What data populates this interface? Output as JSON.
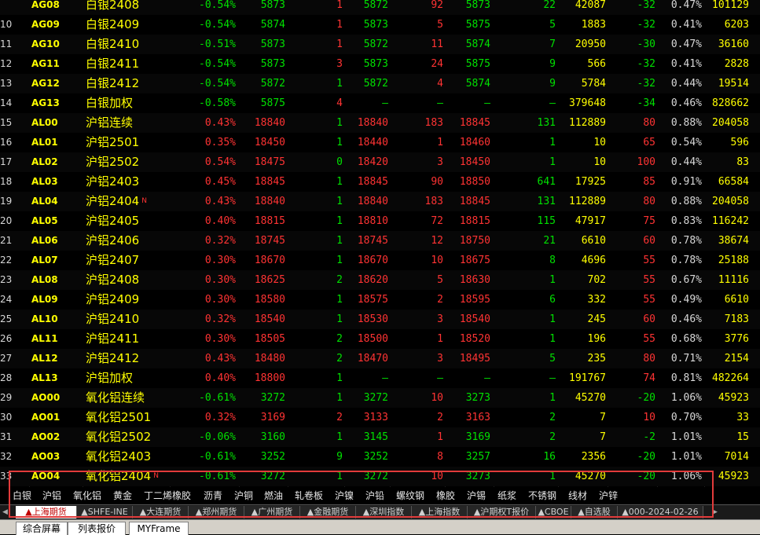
{
  "rows": [
    {
      "idx": "",
      "code": "AG08",
      "name": "白银2408",
      "flag": "",
      "pct": "-0.54%",
      "dir": "dn",
      "last": "5873",
      "vol": "1",
      "vcol": "up",
      "bid": "5872",
      "bidv": "92",
      "ask": "5873",
      "askv": "22",
      "tot": "42087",
      "chg": "-32",
      "chgdir": "dn",
      "opt": "0.47%",
      "oi": "101129"
    },
    {
      "idx": "10",
      "code": "AG09",
      "name": "白银2409",
      "flag": "",
      "pct": "-0.54%",
      "dir": "dn",
      "last": "5874",
      "vol": "1",
      "vcol": "up",
      "bid": "5873",
      "bidv": "5",
      "ask": "5875",
      "askv": "5",
      "tot": "1883",
      "chg": "-32",
      "chgdir": "dn",
      "opt": "0.41%",
      "oi": "6203"
    },
    {
      "idx": "11",
      "code": "AG10",
      "name": "白银2410",
      "flag": "",
      "pct": "-0.51%",
      "dir": "dn",
      "last": "5873",
      "vol": "1",
      "vcol": "up",
      "bid": "5872",
      "bidv": "11",
      "ask": "5874",
      "askv": "7",
      "tot": "20950",
      "chg": "-30",
      "chgdir": "dn",
      "opt": "0.47%",
      "oi": "36160"
    },
    {
      "idx": "12",
      "code": "AG11",
      "name": "白银2411",
      "flag": "",
      "pct": "-0.54%",
      "dir": "dn",
      "last": "5873",
      "vol": "3",
      "vcol": "up",
      "bid": "5873",
      "bidv": "24",
      "ask": "5875",
      "askv": "9",
      "tot": "566",
      "chg": "-32",
      "chgdir": "dn",
      "opt": "0.41%",
      "oi": "2828"
    },
    {
      "idx": "13",
      "code": "AG12",
      "name": "白银2412",
      "flag": "",
      "pct": "-0.54%",
      "dir": "dn",
      "last": "5872",
      "vol": "1",
      "vcol": "dn",
      "bid": "5872",
      "bidv": "4",
      "ask": "5874",
      "askv": "9",
      "tot": "5784",
      "chg": "-32",
      "chgdir": "dn",
      "opt": "0.44%",
      "oi": "19514"
    },
    {
      "idx": "14",
      "code": "AG13",
      "name": "白银加权",
      "flag": "",
      "pct": "-0.58%",
      "dir": "dn",
      "last": "5875",
      "vol": "4",
      "vcol": "up",
      "bid": "–",
      "bidv": "–",
      "ask": "–",
      "askv": "–",
      "tot": "379648",
      "chg": "-34",
      "chgdir": "dn",
      "opt": "0.46%",
      "oi": "828662"
    },
    {
      "idx": "15",
      "code": "AL00",
      "name": "沪铝连续",
      "flag": "",
      "pct": "0.43%",
      "dir": "up",
      "last": "18840",
      "vol": "1",
      "vcol": "dn",
      "bid": "18840",
      "bidv": "183",
      "ask": "18845",
      "askv": "131",
      "tot": "112889",
      "chg": "80",
      "chgdir": "up",
      "opt": "0.88%",
      "oi": "204058"
    },
    {
      "idx": "16",
      "code": "AL01",
      "name": "沪铝2501",
      "flag": "",
      "pct": "0.35%",
      "dir": "up",
      "last": "18450",
      "vol": "1",
      "vcol": "dn",
      "bid": "18440",
      "bidv": "1",
      "ask": "18460",
      "askv": "1",
      "tot": "10",
      "chg": "65",
      "chgdir": "up",
      "opt": "0.54%",
      "oi": "596"
    },
    {
      "idx": "17",
      "code": "AL02",
      "name": "沪铝2502",
      "flag": "",
      "pct": "0.54%",
      "dir": "up",
      "last": "18475",
      "vol": "0",
      "vcol": "dn",
      "bid": "18420",
      "bidv": "3",
      "ask": "18450",
      "askv": "1",
      "tot": "10",
      "chg": "100",
      "chgdir": "up",
      "opt": "0.44%",
      "oi": "83"
    },
    {
      "idx": "18",
      "code": "AL03",
      "name": "沪铝2403",
      "flag": "",
      "pct": "0.45%",
      "dir": "up",
      "last": "18845",
      "vol": "1",
      "vcol": "dn",
      "bid": "18845",
      "bidv": "90",
      "ask": "18850",
      "askv": "641",
      "tot": "17925",
      "chg": "85",
      "chgdir": "up",
      "opt": "0.91%",
      "oi": "66584"
    },
    {
      "idx": "19",
      "code": "AL04",
      "name": "沪铝2404",
      "flag": "N",
      "pct": "0.43%",
      "dir": "up",
      "last": "18840",
      "vol": "1",
      "vcol": "dn",
      "bid": "18840",
      "bidv": "183",
      "ask": "18845",
      "askv": "131",
      "tot": "112889",
      "chg": "80",
      "chgdir": "up",
      "opt": "0.88%",
      "oi": "204058"
    },
    {
      "idx": "20",
      "code": "AL05",
      "name": "沪铝2405",
      "flag": "",
      "pct": "0.40%",
      "dir": "up",
      "last": "18815",
      "vol": "1",
      "vcol": "dn",
      "bid": "18810",
      "bidv": "72",
      "ask": "18815",
      "askv": "115",
      "tot": "47917",
      "chg": "75",
      "chgdir": "up",
      "opt": "0.83%",
      "oi": "116242"
    },
    {
      "idx": "21",
      "code": "AL06",
      "name": "沪铝2406",
      "flag": "",
      "pct": "0.32%",
      "dir": "up",
      "last": "18745",
      "vol": "1",
      "vcol": "dn",
      "bid": "18745",
      "bidv": "12",
      "ask": "18750",
      "askv": "21",
      "tot": "6610",
      "chg": "60",
      "chgdir": "up",
      "opt": "0.78%",
      "oi": "38674"
    },
    {
      "idx": "22",
      "code": "AL07",
      "name": "沪铝2407",
      "flag": "",
      "pct": "0.30%",
      "dir": "up",
      "last": "18670",
      "vol": "1",
      "vcol": "dn",
      "bid": "18670",
      "bidv": "10",
      "ask": "18675",
      "askv": "8",
      "tot": "4696",
      "chg": "55",
      "chgdir": "up",
      "opt": "0.78%",
      "oi": "25188"
    },
    {
      "idx": "23",
      "code": "AL08",
      "name": "沪铝2408",
      "flag": "",
      "pct": "0.30%",
      "dir": "up",
      "last": "18625",
      "vol": "2",
      "vcol": "dn",
      "bid": "18620",
      "bidv": "5",
      "ask": "18630",
      "askv": "1",
      "tot": "702",
      "chg": "55",
      "chgdir": "up",
      "opt": "0.67%",
      "oi": "11116"
    },
    {
      "idx": "24",
      "code": "AL09",
      "name": "沪铝2409",
      "flag": "",
      "pct": "0.30%",
      "dir": "up",
      "last": "18580",
      "vol": "1",
      "vcol": "dn",
      "bid": "18575",
      "bidv": "2",
      "ask": "18595",
      "askv": "6",
      "tot": "332",
      "chg": "55",
      "chgdir": "up",
      "opt": "0.49%",
      "oi": "6610"
    },
    {
      "idx": "25",
      "code": "AL10",
      "name": "沪铝2410",
      "flag": "",
      "pct": "0.32%",
      "dir": "up",
      "last": "18540",
      "vol": "1",
      "vcol": "dn",
      "bid": "18530",
      "bidv": "3",
      "ask": "18540",
      "askv": "1",
      "tot": "245",
      "chg": "60",
      "chgdir": "up",
      "opt": "0.46%",
      "oi": "7183"
    },
    {
      "idx": "26",
      "code": "AL11",
      "name": "沪铝2411",
      "flag": "",
      "pct": "0.30%",
      "dir": "up",
      "last": "18505",
      "vol": "2",
      "vcol": "dn",
      "bid": "18500",
      "bidv": "1",
      "ask": "18520",
      "askv": "1",
      "tot": "196",
      "chg": "55",
      "chgdir": "up",
      "opt": "0.68%",
      "oi": "3776"
    },
    {
      "idx": "27",
      "code": "AL12",
      "name": "沪铝2412",
      "flag": "",
      "pct": "0.43%",
      "dir": "up",
      "last": "18480",
      "vol": "2",
      "vcol": "dn",
      "bid": "18470",
      "bidv": "3",
      "ask": "18495",
      "askv": "5",
      "tot": "235",
      "chg": "80",
      "chgdir": "up",
      "opt": "0.71%",
      "oi": "2154"
    },
    {
      "idx": "28",
      "code": "AL13",
      "name": "沪铝加权",
      "flag": "",
      "pct": "0.40%",
      "dir": "up",
      "last": "18800",
      "vol": "1",
      "vcol": "dn",
      "bid": "–",
      "bidv": "–",
      "ask": "–",
      "askv": "–",
      "tot": "191767",
      "chg": "74",
      "chgdir": "up",
      "opt": "0.81%",
      "oi": "482264"
    },
    {
      "idx": "29",
      "code": "AO00",
      "name": "氧化铝连续",
      "flag": "",
      "pct": "-0.61%",
      "dir": "dn",
      "last": "3272",
      "vol": "1",
      "vcol": "dn",
      "bid": "3272",
      "bidv": "10",
      "ask": "3273",
      "askv": "1",
      "tot": "45270",
      "chg": "-20",
      "chgdir": "dn",
      "opt": "1.06%",
      "oi": "45923"
    },
    {
      "idx": "30",
      "code": "AO01",
      "name": "氧化铝2501",
      "flag": "",
      "pct": "0.32%",
      "dir": "up",
      "last": "3169",
      "vol": "2",
      "vcol": "up",
      "bid": "3133",
      "bidv": "2",
      "ask": "3163",
      "askv": "2",
      "tot": "7",
      "chg": "10",
      "chgdir": "up",
      "opt": "0.70%",
      "oi": "33"
    },
    {
      "idx": "31",
      "code": "AO02",
      "name": "氧化铝2502",
      "flag": "",
      "pct": "-0.06%",
      "dir": "dn",
      "last": "3160",
      "vol": "1",
      "vcol": "dn",
      "bid": "3145",
      "bidv": "1",
      "ask": "3169",
      "askv": "2",
      "tot": "7",
      "chg": "-2",
      "chgdir": "dn",
      "opt": "1.01%",
      "oi": "15"
    },
    {
      "idx": "32",
      "code": "AO03",
      "name": "氧化铝2403",
      "flag": "",
      "pct": "-0.61%",
      "dir": "dn",
      "last": "3252",
      "vol": "9",
      "vcol": "dn",
      "bid": "3252",
      "bidv": "8",
      "ask": "3257",
      "askv": "16",
      "tot": "2356",
      "chg": "-20",
      "chgdir": "dn",
      "opt": "1.01%",
      "oi": "7014"
    },
    {
      "idx": "33",
      "code": "AO04",
      "name": "氧化铝2404",
      "flag": "N",
      "pct": "-0.61%",
      "dir": "dn",
      "last": "3272",
      "vol": "1",
      "vcol": "dn",
      "bid": "3272",
      "bidv": "10",
      "ask": "3273",
      "askv": "1",
      "tot": "45270",
      "chg": "-20",
      "chgdir": "dn",
      "opt": "1.06%",
      "oi": "45923"
    }
  ],
  "sub_categories": [
    "白银",
    "沪铝",
    "氧化铝",
    "黄金",
    "丁二烯橡胶",
    "沥青",
    "沪铜",
    "燃油",
    "轧卷板",
    "沪镍",
    "沪铅",
    "螺纹钢",
    "橡胶",
    "沪锡",
    "纸浆",
    "不锈钢",
    "线材",
    "沪锌"
  ],
  "market_tabs": [
    "▲上海期货",
    "▲SHFE-INE",
    "▲大连期货",
    "▲郑州期货",
    "▲广州期货",
    "▲金融期货",
    "▲深圳指数",
    "▲上海指数",
    "▲沪期权T报价",
    "▲CBOE",
    "▲自选股",
    "▲000-2024-02-26"
  ],
  "bottom_tabs": [
    "综合屏幕",
    "列表报价",
    "MYFrame"
  ],
  "colors": {
    "up": "#ff3333",
    "down": "#00e000",
    "code": "#ffff00",
    "highlight_box": "#e23b3b"
  }
}
